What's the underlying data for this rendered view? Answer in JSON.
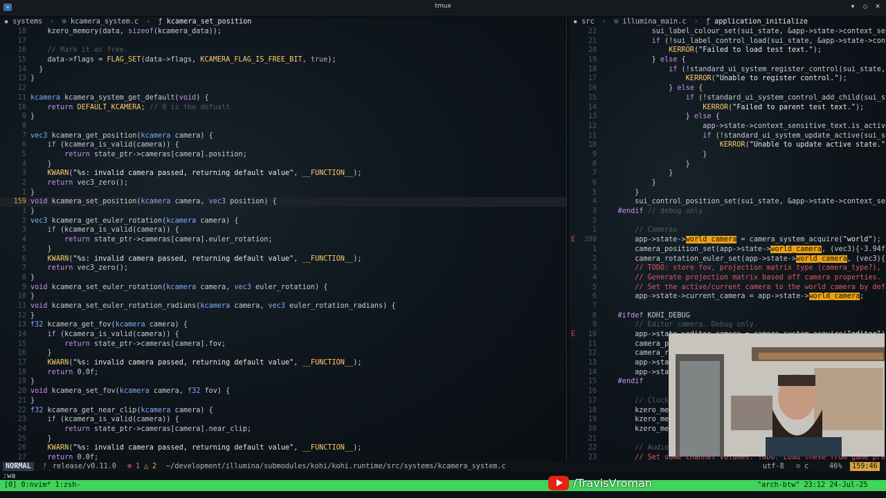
{
  "window": {
    "title": "tmux"
  },
  "left": {
    "breadcrumb": {
      "dir": "systems",
      "file": "kcamera_system.c",
      "symbol": "kcamera_set_position"
    },
    "lines": [
      {
        "n": "18",
        "t": "    kzero_memory(data, sizeof(kcamera_data));"
      },
      {
        "n": "17",
        "t": ""
      },
      {
        "n": "16",
        "t": "    // Mark it as free."
      },
      {
        "n": "15",
        "t": "    data->flags = FLAG_SET(data->flags, KCAMERA_FLAG_IS_FREE_BIT, true);"
      },
      {
        "n": "14",
        "t": "  }"
      },
      {
        "n": "13",
        "t": "}"
      },
      {
        "n": "12",
        "t": ""
      },
      {
        "n": "11",
        "t": "kcamera kcamera_system_get_default(void) {"
      },
      {
        "n": "10",
        "t": "    return DEFAULT_KCAMERA; // 0 is the defualt"
      },
      {
        "n": "9",
        "t": "}"
      },
      {
        "n": "8",
        "t": ""
      },
      {
        "n": "7",
        "t": "vec3 kcamera_get_position(kcamera camera) {"
      },
      {
        "n": "6",
        "t": "    if (kcamera_is_valid(camera)) {"
      },
      {
        "n": "5",
        "t": "        return state_ptr->cameras[camera].position;"
      },
      {
        "n": "4",
        "t": "    }"
      },
      {
        "n": "3",
        "t": "    KWARN(\"%s: invalid camera passed, returning default value\", __FUNCTION__);"
      },
      {
        "n": "2",
        "t": "    return vec3_zero();"
      },
      {
        "n": "1",
        "t": "}"
      },
      {
        "n": "159",
        "t": "void kcamera_set_position(kcamera camera, vec3 position) {",
        "current": true
      },
      {
        "n": "1",
        "t": "}"
      },
      {
        "n": "2",
        "t": "vec3 kcamera_get_euler_rotation(kcamera camera) {"
      },
      {
        "n": "3",
        "t": "    if (kcamera_is_valid(camera)) {"
      },
      {
        "n": "4",
        "t": "        return state_ptr->cameras[camera].euler_rotation;"
      },
      {
        "n": "5",
        "t": "    }"
      },
      {
        "n": "6",
        "t": "    KWARN(\"%s: invalid camera passed, returning default value\", __FUNCTION__);"
      },
      {
        "n": "7",
        "t": "    return vec3_zero();"
      },
      {
        "n": "8",
        "t": "}"
      },
      {
        "n": "9",
        "t": "void kcamera_set_euler_rotation(kcamera camera, vec3 euler_rotation) {"
      },
      {
        "n": "10",
        "t": "}"
      },
      {
        "n": "11",
        "t": "void kcamera_set_euler_rotation_radians(kcamera camera, vec3 euler_rotation_radians) {"
      },
      {
        "n": "12",
        "t": "}"
      },
      {
        "n": "13",
        "t": "f32 kcamera_get_fov(kcamera camera) {"
      },
      {
        "n": "14",
        "t": "    if (kcamera_is_valid(camera)) {"
      },
      {
        "n": "15",
        "t": "        return state_ptr->cameras[camera].fov;"
      },
      {
        "n": "16",
        "t": "    }"
      },
      {
        "n": "17",
        "t": "    KWARN(\"%s: invalid camera passed, returning default value\", __FUNCTION__);"
      },
      {
        "n": "18",
        "t": "    return 0.0f;"
      },
      {
        "n": "19",
        "t": "}"
      },
      {
        "n": "20",
        "t": "void kcamera_set_fov(kcamera camera, f32 fov) {"
      },
      {
        "n": "21",
        "t": "}"
      },
      {
        "n": "22",
        "t": "f32 kcamera_get_near_clip(kcamera camera) {"
      },
      {
        "n": "23",
        "t": "    if (kcamera_is_valid(camera)) {"
      },
      {
        "n": "24",
        "t": "        return state_ptr->cameras[camera].near_clip;"
      },
      {
        "n": "25",
        "t": "    }"
      },
      {
        "n": "26",
        "t": "    KWARN(\"%s: invalid camera passed, returning default value\", __FUNCTION__);"
      },
      {
        "n": "27",
        "t": "    return 0.0f;"
      }
    ]
  },
  "right": {
    "breadcrumb": {
      "dir": "src",
      "file": "illumina_main.c",
      "symbol": "application_initialize"
    },
    "lines": [
      {
        "n": "22",
        "t": "            sui_label_colour_set(sui_state, &app->state->context_sen"
      },
      {
        "n": "21",
        "t": "            if (!sui_label_control_load(sui_state, &app->state->cont"
      },
      {
        "n": "20",
        "t": "                KERROR(\"Failed to load test text.\");"
      },
      {
        "n": "19",
        "t": "            } else {"
      },
      {
        "n": "18",
        "t": "                if (!standard_ui_system_register_control(sui_state,"
      },
      {
        "n": "17",
        "t": "                    KERROR(\"Unable to register control.\");"
      },
      {
        "n": "16",
        "t": "                } else {"
      },
      {
        "n": "15",
        "t": "                    if (!standard_ui_system_control_add_child(sui_st"
      },
      {
        "n": "14",
        "t": "                        KERROR(\"Failed to parent test text.\");"
      },
      {
        "n": "13",
        "t": "                    } else {"
      },
      {
        "n": "12",
        "t": "                        app->state->context_sensitive_text.is_active"
      },
      {
        "n": "11",
        "t": "                        if (!standard_ui_system_update_active(sui_st"
      },
      {
        "n": "10",
        "t": "                            KERROR(\"Unable to update active state.\")"
      },
      {
        "n": "9",
        "t": "                        }"
      },
      {
        "n": "8",
        "t": "                    }"
      },
      {
        "n": "7",
        "t": "                }"
      },
      {
        "n": "6",
        "t": "            }"
      },
      {
        "n": "5",
        "t": "        }"
      },
      {
        "n": "4",
        "t": "        sui_control_position_set(sui_state, &app->state->context_sen"
      },
      {
        "n": "3",
        "t": "    #endif // debug only"
      },
      {
        "n": "2",
        "t": ""
      },
      {
        "n": "1",
        "t": "        // Cameras"
      },
      {
        "n": "380",
        "t": "        app->state->world_camera = camera_system_acquire(\"world\");",
        "sign": "E"
      },
      {
        "n": "1",
        "t": "        camera_position_set(app->state->world_camera, (vec3){-3.94f,"
      },
      {
        "n": "2",
        "t": "        camera_rotation_euler_set(app->state->world_camera, (vec3){-"
      },
      {
        "n": "3",
        "t": "        // TODO: store fov, projection matrix type (camera_type?), n"
      },
      {
        "n": "4",
        "t": "        // Generate projection matrix based off camera properties."
      },
      {
        "n": "5",
        "t": "        // Set the active/current camera to the world camera by defa"
      },
      {
        "n": "6",
        "t": "        app->state->current_camera = app->state->world_camera;"
      },
      {
        "n": "7",
        "t": ""
      },
      {
        "n": "8",
        "t": "    #ifdef KOHI_DEBUG"
      },
      {
        "n": "9",
        "t": "        // Editor camera. Debug only."
      },
      {
        "n": "10",
        "t": "        app->state->editor_camera = camera_system_acquire(\"editor\");",
        "sign": "E"
      },
      {
        "n": "11",
        "t": "        camera_posit"
      },
      {
        "n": "12",
        "t": "        camera_rotat"
      },
      {
        "n": "13",
        "t": "        app->state->"
      },
      {
        "n": "14",
        "t": "        app->state->"
      },
      {
        "n": "15",
        "t": "    #endif"
      },
      {
        "n": "16",
        "t": ""
      },
      {
        "n": "17",
        "t": "        // Clocks"
      },
      {
        "n": "18",
        "t": "        kzero_memory"
      },
      {
        "n": "19",
        "t": "        kzero_memory"
      },
      {
        "n": "20",
        "t": "        kzero_memory"
      },
      {
        "n": "21",
        "t": ""
      },
      {
        "n": "22",
        "t": "        // Audio"
      },
      {
        "n": "23",
        "t": "        // Set some channel volumes. TODO: Load these from game pref"
      }
    ]
  },
  "status": {
    "mode": "NORMAL",
    "branch": "release/v0.11.0",
    "errors": "1",
    "warnings": "2",
    "path": "~/development/illumina/submodules/kohi/kohi.runtime/src/systems/kcamera_system.c",
    "encoding": "utf-8",
    "filetype": "c",
    "percent": "46%",
    "position": "159:46"
  },
  "cmdline": ":wa",
  "tmux": {
    "windows": "[0] 0:nvim* 1:zsh-",
    "host": "\"arch-btw\" 23:12 24-Jul-25"
  },
  "overlay": {
    "channel": "/TravisVroman"
  },
  "colors": {
    "keyword": "#c792ea",
    "type": "#82aaff",
    "func": "#82aaff",
    "string": "#e8e8e8",
    "macro": "#ffcb6b",
    "comment": "#4f5c66",
    "highlight": "#e8a317",
    "todo": "#e05a5a"
  }
}
